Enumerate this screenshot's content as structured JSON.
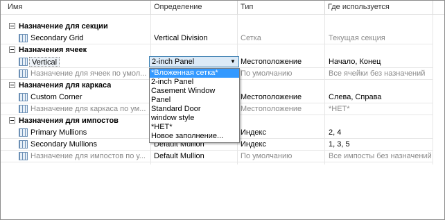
{
  "columns": [
    "Имя",
    "Определение",
    "Тип",
    "Где используется"
  ],
  "rows": [
    {
      "kind": "group",
      "name": "Назначение для секции"
    },
    {
      "kind": "item",
      "name": "Secondary Grid",
      "definition": "Vertical Division",
      "type": "Сетка",
      "where": "Текущая секция",
      "dim_type": true
    },
    {
      "kind": "group",
      "name": "Назначения ячеек"
    },
    {
      "kind": "item",
      "name": "Vertical",
      "definition": "",
      "type": "Местоположение",
      "where": "Начало, Конец",
      "highlight": true
    },
    {
      "kind": "item",
      "name": "Назначение для ячеек по умол...",
      "definition": "",
      "type": "По умолчанию",
      "where": "Все ячейки без назначений",
      "dim": true
    },
    {
      "kind": "group",
      "name": "Назначения для каркаса"
    },
    {
      "kind": "item",
      "name": "Custom Corner",
      "definition": "",
      "type": "Местоположение",
      "where": "Слева, Справа"
    },
    {
      "kind": "item",
      "name": "Назначение для каркаса по ум...",
      "definition": "",
      "type": "Местоположение",
      "where": "*НЕТ*",
      "dim": true
    },
    {
      "kind": "group",
      "name": "Назначения для импостов"
    },
    {
      "kind": "item",
      "name": "Primary Mullions",
      "definition": "",
      "type": "Индекс",
      "where": "2, 4"
    },
    {
      "kind": "item",
      "name": "Secondary Mullions",
      "definition": "Default Mullion",
      "type": "Индекс",
      "where": "1, 3, 5"
    },
    {
      "kind": "item",
      "name": "Назначение для импостов по у...",
      "definition": "Default Mullion",
      "type": "По умолчанию",
      "where": "Все импосты без назначений",
      "dim": true
    }
  ],
  "combo": {
    "value": "2-inch Panel",
    "arrow": "▼"
  },
  "dropdown": {
    "selected_index": 0,
    "items": [
      "*Вложенная сетка*",
      "2-inch Panel",
      "Casement Window",
      "Panel",
      "Standard Door",
      "window style",
      "*НЕТ*",
      "Новое заполнение..."
    ]
  },
  "colors": {
    "selection": "#3399ff",
    "combo_border": "#3c7fb1",
    "dim_text": "#8a8a8a"
  }
}
